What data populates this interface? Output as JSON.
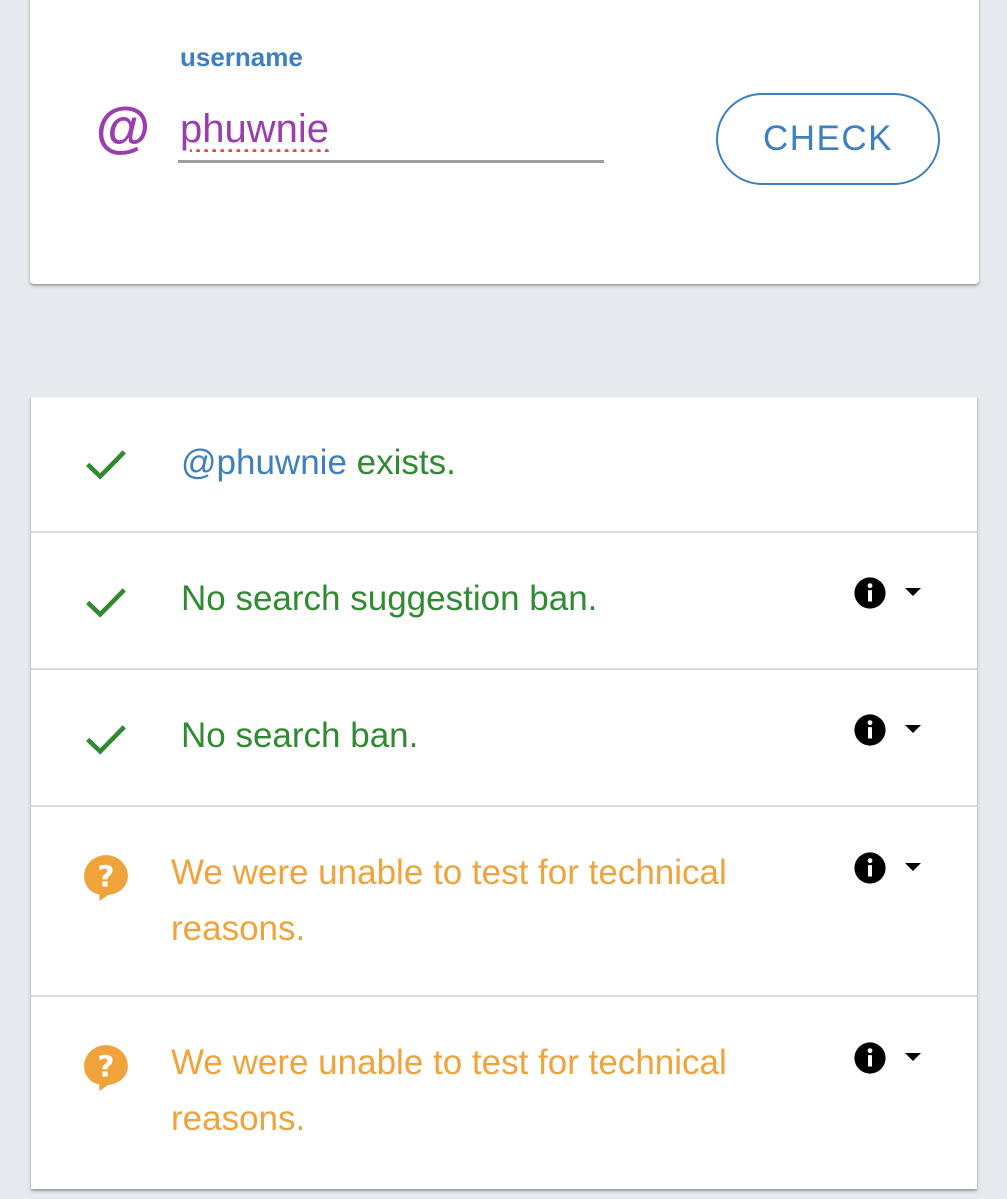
{
  "search": {
    "label": "username",
    "at_symbol": "@",
    "value": "phuwnie",
    "button_label": "CHECK"
  },
  "results": [
    {
      "status": "ok",
      "icon": "check-icon",
      "handle": "@phuwnie",
      "text": " exists."
    },
    {
      "status": "ok",
      "icon": "check-icon",
      "text": "No search suggestion ban.",
      "info_icon": "info-icon",
      "dropdown_icon": "caret-down-icon"
    },
    {
      "status": "ok",
      "icon": "check-icon",
      "text": "No search ban.",
      "info_icon": "info-icon",
      "dropdown_icon": "caret-down-icon"
    },
    {
      "status": "unknown",
      "icon": "question-bubble-icon",
      "text": "We were unable to test for technical reasons.",
      "info_icon": "info-icon",
      "dropdown_icon": "caret-down-icon"
    },
    {
      "status": "unknown",
      "icon": "question-bubble-icon",
      "text": "We were unable to test for technical reasons.",
      "info_icon": "info-icon",
      "dropdown_icon": "caret-down-icon"
    }
  ],
  "colors": {
    "accent_blue": "#3d7fbf",
    "username_purple": "#9a3db0",
    "ok_green": "#2f8a32",
    "warn_orange": "#f0a33a",
    "background": "#e6e9ee"
  }
}
